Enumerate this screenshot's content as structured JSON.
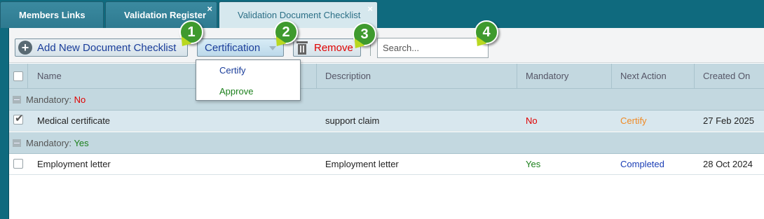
{
  "tabs": [
    {
      "label": "Members Links"
    },
    {
      "label": "Validation Register"
    },
    {
      "label": "Validation Document Checklist"
    }
  ],
  "tab_close_glyph": "×",
  "toolbar": {
    "add_label": "Add New Document Checklist",
    "add_icon": "plus-circle-icon",
    "certification_label": "Certification",
    "remove_label": "Remove",
    "remove_icon": "trash-icon",
    "search_placeholder": "Search..."
  },
  "callouts": [
    "1",
    "2",
    "3",
    "4"
  ],
  "certification_menu": {
    "items": [
      {
        "label": "Certify",
        "color": "#1a3d9a"
      },
      {
        "label": "Approve",
        "color": "#1b7f1b"
      }
    ]
  },
  "grid": {
    "columns": [
      "Name",
      "Description",
      "Mandatory",
      "Next Action",
      "Created On"
    ],
    "groups": [
      {
        "label": "Mandatory:",
        "value": "No",
        "rows": [
          {
            "name": "Medical certificate",
            "description": "support claim",
            "mandatory": "No",
            "next_action": "Certify",
            "created_on": "27 Feb 2025",
            "checked": true
          }
        ]
      },
      {
        "label": "Mandatory:",
        "value": "Yes",
        "rows": [
          {
            "name": "Employment letter",
            "description": "Employment letter",
            "mandatory": "Yes",
            "next_action": "Completed",
            "created_on": "28 Oct 2024",
            "checked": false
          }
        ]
      }
    ]
  },
  "colors": {
    "brand_teal": "#0f6a7e",
    "no_red": "#e00000",
    "yes_green": "#1b7f1b",
    "certify_orange": "#f08a24",
    "completed_blue": "#1a3db5",
    "callout_green": "#3f9a2e"
  }
}
